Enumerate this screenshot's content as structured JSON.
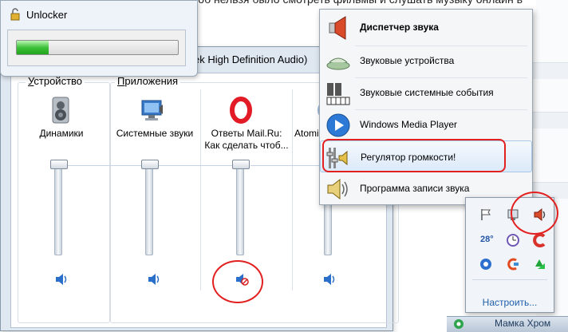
{
  "background": {
    "text": "компе, очень нужно что то сделать, чтоб нельзя было смотреть фильмы и слушать музыку онлайн в"
  },
  "unlocker": {
    "title": "Unlocker",
    "progress_fraction": 0.2
  },
  "mixer": {
    "title_fragment": "ek High Definition Audio)",
    "device_group_label": "Устройство",
    "device_group_accel": "У",
    "apps_group_label": "Приложения",
    "apps_group_accel": "П",
    "channels": [
      {
        "label": "Динамики",
        "icon": "speaker-device-icon",
        "muted": false
      },
      {
        "label": "Системные звуки",
        "icon": "system-sounds-icon",
        "muted": false
      },
      {
        "label_line1": "Ответы Mail.Ru:",
        "label_line2": "Как сделать чтоб...",
        "icon": "opera-icon",
        "muted": true
      },
      {
        "label": "Atomi",
        "icon": "atomic-app-icon",
        "muted": false
      }
    ],
    "colors": {
      "window_frame": "#dfe7f1",
      "track_line": "#c5d3e2"
    }
  },
  "context_menu": {
    "items": [
      {
        "label": "Диспетчер звука",
        "icon": "speaker-red-icon"
      },
      {
        "label": "Звуковые устройства",
        "icon": "sound-devices-icon"
      },
      {
        "label": "Звуковые системные события",
        "icon": "system-events-icon"
      },
      {
        "label": "Windows Media Player",
        "icon": "media-player-icon"
      },
      {
        "label": "Регулятор громкости!",
        "icon": "volume-mixer-icon"
      },
      {
        "label": "Программа записи звука",
        "icon": "sound-recorder-icon"
      }
    ]
  },
  "tray": {
    "temperature": "28°",
    "customize_link": "Настроить..."
  },
  "taskbar": {
    "text": "Мамка Хром"
  },
  "annotations": {
    "color": "#e32020"
  }
}
